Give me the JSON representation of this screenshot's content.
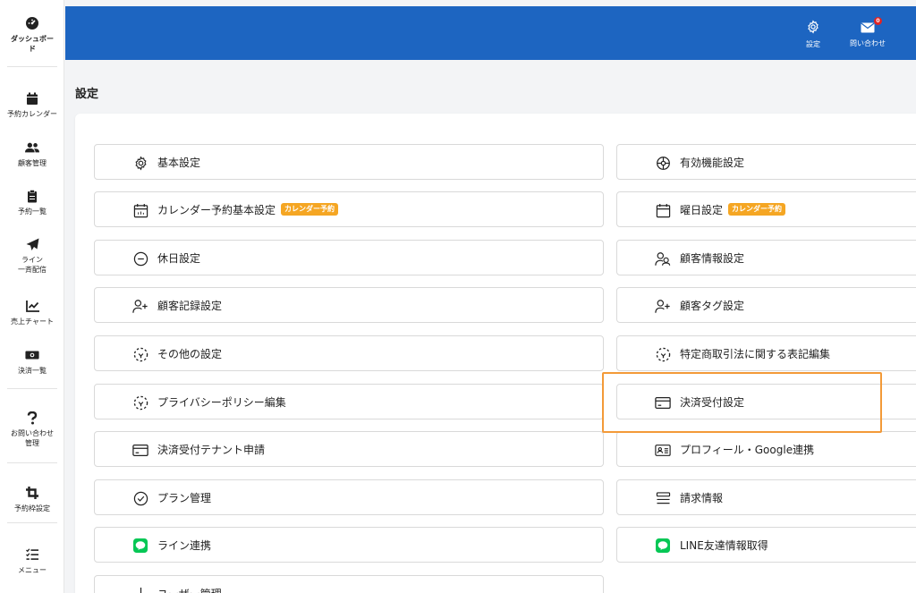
{
  "sidebar": {
    "items": [
      {
        "label": "ダッシュボー\nド",
        "icon": "dashboard-gauge-icon"
      },
      {
        "label": "予約カレンダー",
        "icon": "calendar-icon"
      },
      {
        "label": "顧客管理",
        "icon": "users-icon"
      },
      {
        "label": "予約一覧",
        "icon": "clipboard-icon"
      },
      {
        "label": "ライン\n一斉配信",
        "icon": "paper-plane-icon"
      },
      {
        "label": "売上チャート",
        "icon": "chart-line-icon"
      },
      {
        "label": "決済一覧",
        "icon": "money-bill-icon"
      },
      {
        "label": "お問い合わせ\n管理",
        "icon": "question-icon"
      },
      {
        "label": "予約枠設定",
        "icon": "crop-icon"
      },
      {
        "label": "メニュー",
        "icon": "list-check-icon"
      }
    ]
  },
  "header": {
    "settings_label": "設定",
    "contact_label": "問い合わせ",
    "contact_badge": "0",
    "brand_color": "#1d65c1"
  },
  "page": {
    "title": "設定"
  },
  "settings": {
    "left": [
      {
        "label": "基本設定",
        "icon": "gear-icon"
      },
      {
        "label": "カレンダー予約基本設定",
        "icon": "calendar-icon",
        "tag": "カレンダー予約"
      },
      {
        "label": "休日設定",
        "icon": "minus-circle-icon"
      },
      {
        "label": "顧客記録設定",
        "icon": "user-plus-icon"
      },
      {
        "label": "その他の設定",
        "icon": "dashed-circle-icon"
      },
      {
        "label": "プライバシーポリシー編集",
        "icon": "dashed-circle-icon"
      },
      {
        "label": "決済受付テナント申請",
        "icon": "credit-card-icon"
      },
      {
        "label": "プラン管理",
        "icon": "check-circle-icon"
      },
      {
        "label": "ライン連携",
        "icon": "line-icon"
      },
      {
        "label": "ユーザー管理",
        "icon": "user-icon"
      }
    ],
    "right": [
      {
        "label": "有効機能設定",
        "icon": "gear-dial-icon"
      },
      {
        "label": "曜日設定",
        "icon": "calendar-icon",
        "tag": "カレンダー予約"
      },
      {
        "label": "顧客情報設定",
        "icon": "users-icon"
      },
      {
        "label": "顧客タグ設定",
        "icon": "user-plus-icon"
      },
      {
        "label": "特定商取引法に関する表記編集",
        "icon": "dashed-circle-icon"
      },
      {
        "label": "決済受付設定",
        "icon": "credit-card-icon"
      },
      {
        "label": "プロフィール・Google連携",
        "icon": "id-card-icon"
      },
      {
        "label": "請求情報",
        "icon": "stack-icon"
      },
      {
        "label": "LINE友達情報取得",
        "icon": "line-icon"
      }
    ]
  },
  "colors": {
    "tag": "#f5a623",
    "highlight": "#f39a38",
    "line_green": "#06c755"
  }
}
